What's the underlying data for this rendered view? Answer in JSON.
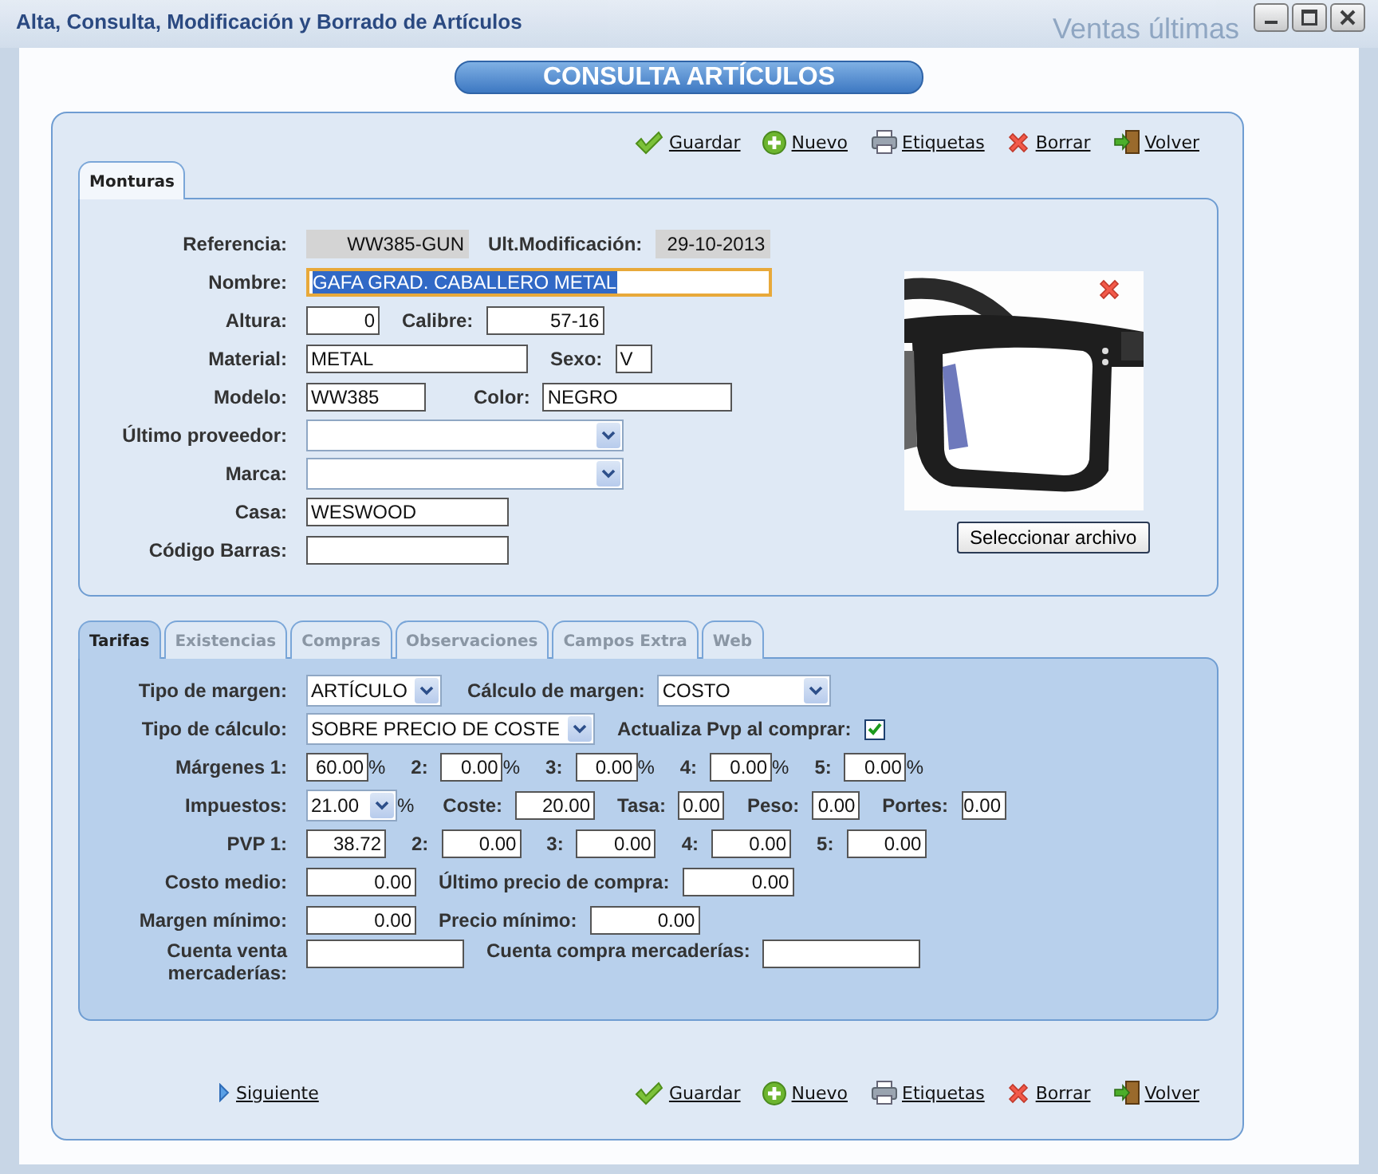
{
  "backdrop": {
    "texts": [
      "Ventas últimas"
    ]
  },
  "window": {
    "title": "Alta, Consulta, Modificación y Borrado de Artículos",
    "controls": [
      {
        "kind": "minimize"
      },
      {
        "kind": "maximize"
      },
      {
        "kind": "close"
      }
    ]
  },
  "heading": "CONSULTA ARTÍCULOS",
  "toolbar": [
    {
      "label": "Guardar",
      "kind": "check"
    },
    {
      "label": "Nuevo",
      "kind": "plus"
    },
    {
      "label": "Etiquetas",
      "kind": "printer"
    },
    {
      "label": "Borrar",
      "kind": "cross"
    },
    {
      "label": "Volver",
      "kind": "exit"
    }
  ],
  "top_tabs": [
    {
      "label": "Monturas",
      "selected": true
    }
  ],
  "general": {
    "rows": [
      {
        "fields": [
          {
            "label": "Referencia:",
            "kind": "readonly",
            "value": "WW385-GUN"
          },
          {
            "label": "Ult.Modificación:",
            "kind": "readonly",
            "value": "29-10-2013"
          }
        ]
      },
      {
        "fields": [
          {
            "label": "Nombre:",
            "kind": "text",
            "value": "GAFA GRAD. CABALLERO METAL",
            "focused": true
          }
        ]
      },
      {
        "fields": [
          {
            "label": "Altura:",
            "kind": "number",
            "value": "0"
          },
          {
            "label": "Calibre:",
            "kind": "number",
            "value": "57-16"
          }
        ]
      },
      {
        "fields": [
          {
            "label": "Material:",
            "kind": "text",
            "value": "METAL"
          },
          {
            "label": "Sexo:",
            "kind": "text",
            "value": "V"
          }
        ]
      },
      {
        "fields": [
          {
            "label": "Modelo:",
            "kind": "text",
            "value": "WW385"
          },
          {
            "label": "Color:",
            "kind": "text",
            "value": "NEGRO"
          }
        ]
      },
      {
        "fields": [
          {
            "label": "Último proveedor:",
            "kind": "select"
          }
        ]
      },
      {
        "fields": [
          {
            "label": "Marca:",
            "kind": "select"
          }
        ]
      },
      {
        "fields": [
          {
            "label": "Casa:",
            "kind": "text",
            "value": "WESWOOD"
          }
        ]
      },
      {
        "fields": [
          {
            "label": "Código Barras:",
            "kind": "text"
          }
        ]
      }
    ],
    "image": {
      "kind": "picture",
      "file_button": "Seleccionar archivo"
    }
  },
  "detail_tabs": [
    {
      "label": "Tarifas",
      "selected": true
    },
    {
      "label": "Existencias",
      "selected": false
    },
    {
      "label": "Compras",
      "selected": false
    },
    {
      "label": "Observaciones",
      "selected": false
    },
    {
      "label": "Campos Extra",
      "selected": false
    },
    {
      "label": "Web",
      "selected": false
    }
  ],
  "tarifas": {
    "rows": [
      {
        "fields": [
          {
            "label": "Tipo de margen:",
            "kind": "select",
            "value": "ARTÍCULO"
          },
          {
            "label": "Cálculo de margen:",
            "kind": "select",
            "value": "COSTO"
          }
        ]
      },
      {
        "fields": [
          {
            "label": "Tipo de cálculo:",
            "kind": "select",
            "value": "SOBRE PRECIO DE COSTE"
          },
          {
            "label": "Actualiza Pvp al comprar:",
            "kind": "checkbox",
            "checked": true
          }
        ]
      },
      {
        "fields": [
          {
            "label": "Márgenes 1:",
            "kind": "number",
            "value": "60.00",
            "suffix": "%"
          },
          {
            "label": "2:",
            "kind": "number",
            "value": "0.00",
            "suffix": "%"
          },
          {
            "label": "3:",
            "kind": "number",
            "value": "0.00",
            "suffix": "%"
          },
          {
            "label": "4:",
            "kind": "number",
            "value": "0.00",
            "suffix": "%"
          },
          {
            "label": "5:",
            "kind": "number",
            "value": "0.00",
            "suffix": "%"
          }
        ]
      },
      {
        "fields": [
          {
            "label": "Impuestos:",
            "kind": "select",
            "value": "21.00",
            "suffix": "%"
          },
          {
            "label": "Coste:",
            "kind": "number",
            "value": "20.00"
          },
          {
            "label": "Tasa:",
            "kind": "number",
            "value": "0.00"
          },
          {
            "label": "Peso:",
            "kind": "number",
            "value": "0.00"
          },
          {
            "label": "Portes:",
            "kind": "number",
            "value": "0.00"
          }
        ]
      },
      {
        "fields": [
          {
            "label": "PVP 1:",
            "kind": "number",
            "value": "38.72"
          },
          {
            "label": "2:",
            "kind": "number",
            "value": "0.00"
          },
          {
            "label": "3:",
            "kind": "number",
            "value": "0.00"
          },
          {
            "label": "4:",
            "kind": "number",
            "value": "0.00"
          },
          {
            "label": "5:",
            "kind": "number",
            "value": "0.00"
          }
        ]
      },
      {
        "fields": [
          {
            "label": "Costo medio:",
            "kind": "number",
            "value": "0.00"
          },
          {
            "label": "Último precio de compra:",
            "kind": "number",
            "value": "0.00"
          }
        ]
      },
      {
        "fields": [
          {
            "label": "Margen mínimo:",
            "kind": "number",
            "value": "0.00"
          },
          {
            "label": "Precio mínimo:",
            "kind": "number",
            "value": "0.00"
          }
        ]
      },
      {
        "fields": [
          {
            "label": "Cuenta venta mercaderías:",
            "kind": "text"
          },
          {
            "label": "Cuenta compra mercaderías:",
            "kind": "text"
          }
        ]
      }
    ]
  },
  "footer": {
    "next_link": "Siguiente",
    "toolbar": [
      {
        "label": "Guardar",
        "kind": "check"
      },
      {
        "label": "Nuevo",
        "kind": "plus"
      },
      {
        "label": "Etiquetas",
        "kind": "printer"
      },
      {
        "label": "Borrar",
        "kind": "cross"
      },
      {
        "label": "Volver",
        "kind": "exit"
      }
    ]
  }
}
